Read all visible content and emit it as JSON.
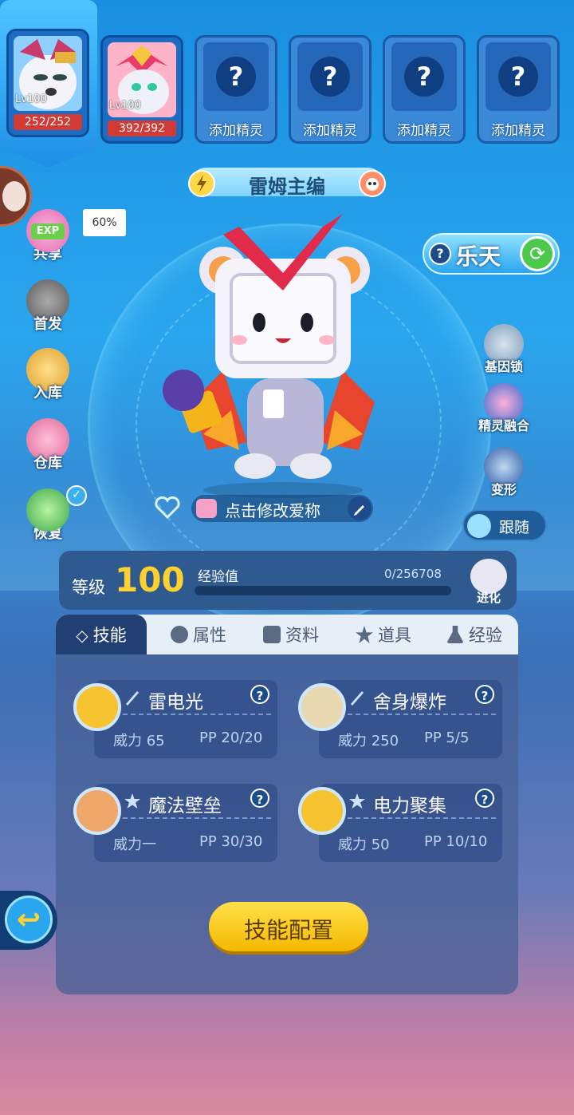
{
  "team": {
    "slots": [
      {
        "level": "Lv100",
        "hp": "252/252",
        "selected": true
      },
      {
        "level": "Lv100",
        "hp": "392/392",
        "selected": false
      },
      {
        "label": "添加精灵"
      },
      {
        "label": "添加精灵"
      },
      {
        "label": "添加精灵"
      },
      {
        "label": "添加精灵"
      }
    ]
  },
  "pet": {
    "name": "雷姆主编",
    "nickname_hint": "点击修改爱称"
  },
  "left_menu": {
    "share_label": "共享",
    "share_badge": "EXP",
    "share_percent": "60%",
    "lead_label": "首发",
    "store_label": "入库",
    "warehouse_label": "仓库",
    "heal_label": "恢复"
  },
  "right_menu": {
    "letian_label": "乐天",
    "gene_lock_label": "基因锁",
    "fusion_label": "精灵融合",
    "transform_label": "变形",
    "follow_label": "跟随"
  },
  "level_bar": {
    "level_key": "等级",
    "level_value": "100",
    "exp_key": "经验值",
    "exp_value": "0/256708",
    "exp_fraction": 0,
    "evolve_label": "进化"
  },
  "tabs": [
    {
      "label": "技能",
      "active": true
    },
    {
      "label": "属性",
      "active": false
    },
    {
      "label": "资料",
      "active": false
    },
    {
      "label": "道具",
      "active": false
    },
    {
      "label": "经验",
      "active": false
    }
  ],
  "skills": [
    {
      "name": "雷电光",
      "power": "威力 65",
      "pp": "PP 20/20"
    },
    {
      "name": "舍身爆炸",
      "power": "威力 250",
      "pp": "PP 5/5"
    },
    {
      "name": "魔法壁垒",
      "power": "威力一",
      "pp": "PP 30/30"
    },
    {
      "name": "电力聚集",
      "power": "威力 50",
      "pp": "PP 10/10"
    }
  ],
  "help_mark": "?",
  "config_button": "技能配置",
  "colors": {
    "accent": "#ffd12e",
    "hp": "#d23a36",
    "panel": "#2f5a8f",
    "tab_active": "#223f73"
  }
}
